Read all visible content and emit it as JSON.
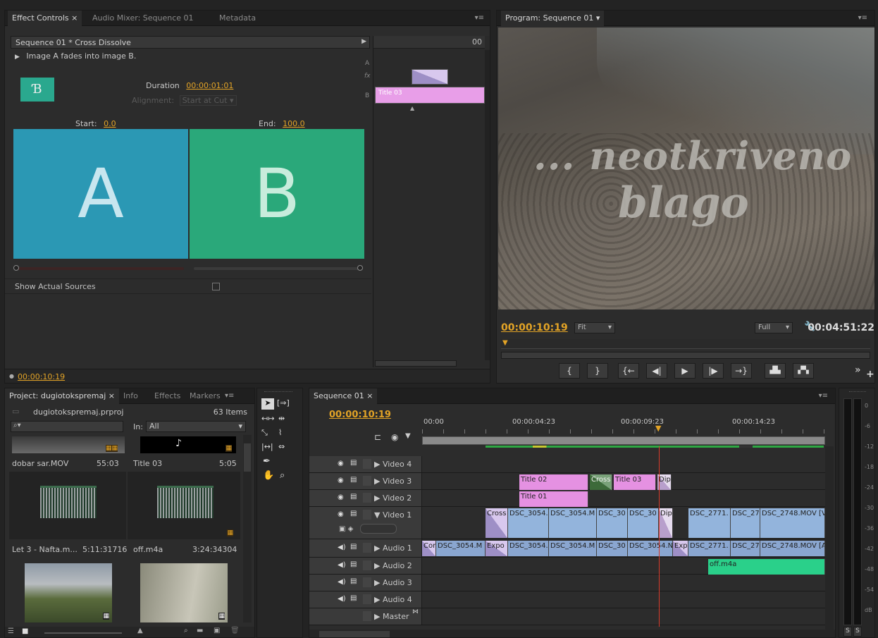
{
  "effect_controls": {
    "tabs": [
      "Effect Controls ×",
      "Audio Mixer: Sequence 01",
      "Metadata"
    ],
    "header": "Sequence 01 * Cross Dissolve",
    "description": "Image A fades into image B.",
    "duration_label": "Duration",
    "duration_value": "00:00:01:01",
    "alignment_label": "Alignment:",
    "alignment_value": "Start at Cut",
    "start_label": "Start:",
    "start_value": "0.0",
    "end_label": "End:",
    "end_value": "100.0",
    "preview_a": "A",
    "preview_b": "B",
    "show_sources_label": "Show Actual Sources",
    "mini_time": "00",
    "mini_a": "A",
    "mini_fx": "fx",
    "mini_b": "B",
    "mini_clip": "Title 03",
    "timecode": "00:00:10:19",
    "colors": {
      "a": "#2b98b4",
      "b": "#2aa87a",
      "accent": "#e2a326"
    }
  },
  "program": {
    "tab": "Program: Sequence 01",
    "overlay_line1": "... neotkriveno",
    "overlay_line2": "blago",
    "timecode": "00:00:10:19",
    "fit_label": "Fit",
    "full_label": "Full",
    "duration": "00:04:51:22"
  },
  "project": {
    "tabs": [
      "Project: dugiotokspremaj ×",
      "Info",
      "Effects",
      "Markers"
    ],
    "file": "dugiotokspremaj.prproj",
    "items_count": "63 Items",
    "in_label": "In:",
    "in_value": "All",
    "items": [
      {
        "name": "dobar sar.MOV",
        "duration": "55:03"
      },
      {
        "name": "Title 03",
        "duration": "5:05"
      },
      {
        "name": "Let 3 - Nafta.m...",
        "duration": "5:11:31716"
      },
      {
        "name": "off.m4a",
        "duration": "3:24:34304"
      }
    ]
  },
  "timeline": {
    "tab": "Sequence 01 ×",
    "timecode": "00:00:10:19",
    "ruler": [
      "00:00",
      "00:00:04:23",
      "00:00:09:23",
      "00:00:14:23"
    ],
    "tracks": {
      "video4": "Video 4",
      "video3": "Video 3",
      "video2": "Video 2",
      "video1": "Video 1",
      "audio1": "Audio 1",
      "audio2": "Audio 2",
      "audio3": "Audio 3",
      "audio4": "Audio 4",
      "master": "Master"
    },
    "v3_clips": [
      "Title 02",
      "Cross",
      "Title 03",
      "Dip"
    ],
    "v2_clips": [
      "Title 01"
    ],
    "v1_clips": [
      "Cross",
      "DSC_3054.",
      "DSC_3054.M",
      "DSC_30",
      "DSC_30",
      "Dip",
      "DSC_2771.",
      "DSC_27",
      "DSC_2748.MOV [V"
    ],
    "a1_clips": [
      "Cor",
      "DSC_3054.M",
      "Expo",
      "DSC_3054.",
      "DSC_3054.M",
      "DSC_30",
      "DSC_3054.N",
      "Exp",
      "DSC_2771.",
      "DSC_27",
      "DSC_2748.MOV [A"
    ],
    "a2_clips": [
      "off.m4a"
    ]
  },
  "meter": {
    "ticks": [
      "0",
      "-6",
      "-12",
      "-18",
      "-24",
      "-30",
      "-36",
      "-42",
      "-48",
      "-54",
      "dB"
    ],
    "buttons": [
      "S",
      "S"
    ]
  }
}
